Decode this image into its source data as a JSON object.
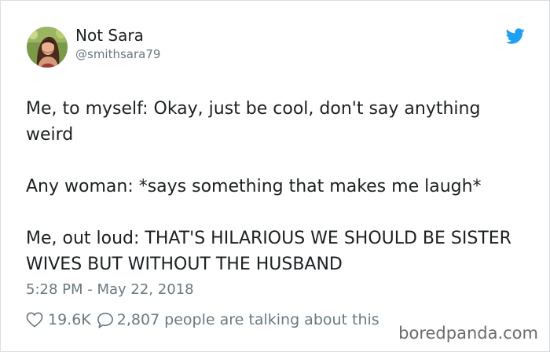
{
  "author": {
    "display_name": "Not Sara",
    "handle": "@smithsara79",
    "avatar_icon": "profile-photo"
  },
  "tweet": {
    "paragraphs": [
      "Me, to myself: Okay, just be cool, don't say anything weird",
      "Any woman: *says something that makes me laugh*",
      "Me, out loud: THAT'S HILARIOUS WE SHOULD BE SISTER WIVES BUT WITHOUT THE HUSBAND"
    ],
    "timestamp": "5:28 PM - May 22, 2018"
  },
  "actions": {
    "likes": "19.6K",
    "replies": "2,807",
    "replies_suffix": "people are talking about this"
  },
  "icons": {
    "brand": "twitter-bird-icon",
    "like": "heart-icon",
    "reply": "speech-bubble-icon"
  },
  "colors": {
    "text_primary": "#1c2022",
    "text_secondary": "#697882",
    "twitter_blue": "#1da1f2",
    "border": "#d8dde2"
  },
  "watermark": {
    "text": "boredpanda.com"
  }
}
